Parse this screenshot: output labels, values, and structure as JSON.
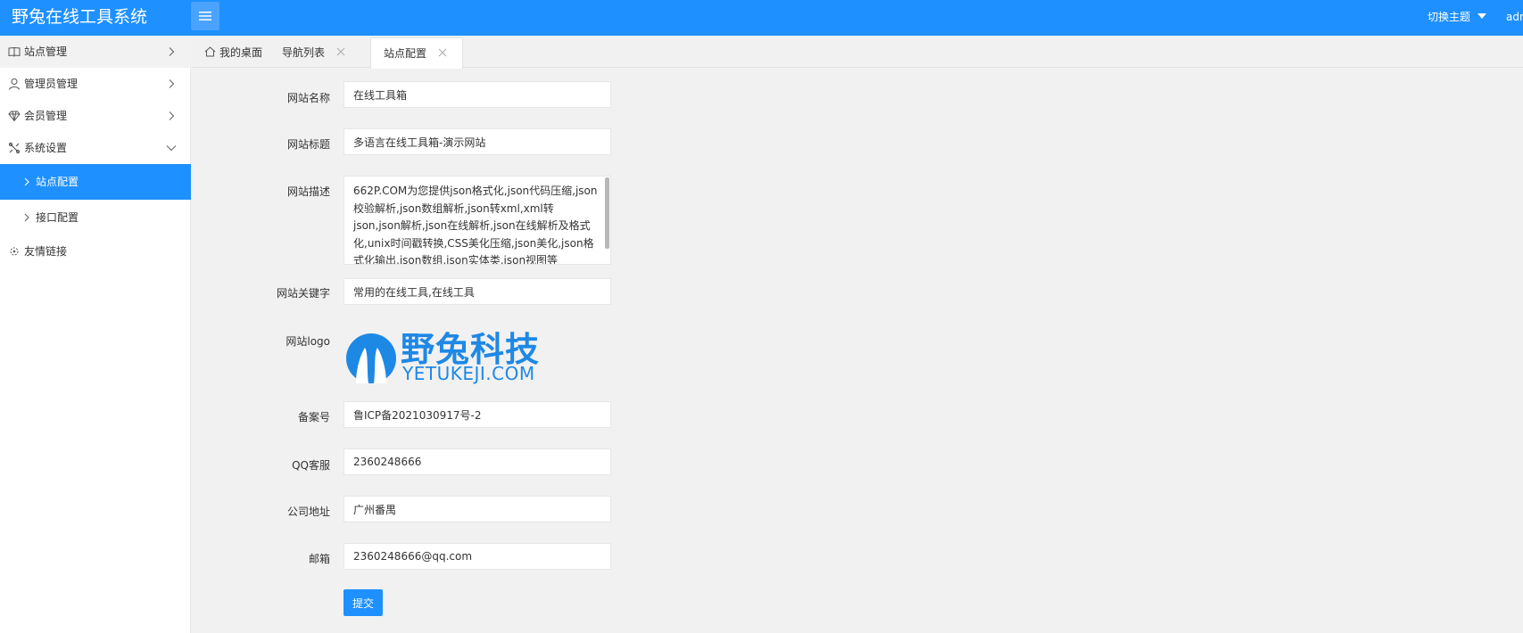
{
  "header": {
    "app_title": "野兔在线工具系统",
    "theme_switch": "切换主题",
    "admin_user": "admin"
  },
  "sidebar": {
    "items": [
      {
        "label": "站点管理",
        "icon": "book-icon"
      },
      {
        "label": "管理员管理",
        "icon": "user-icon"
      },
      {
        "label": "会员管理",
        "icon": "diamond-icon"
      },
      {
        "label": "系统设置",
        "icon": "tools-icon"
      },
      {
        "label": "站点配置"
      },
      {
        "label": "接口配置"
      },
      {
        "label": "友情链接",
        "icon": "link-icon"
      }
    ]
  },
  "tabs": [
    {
      "label": "我的桌面",
      "icon": "home-icon"
    },
    {
      "label": "导航列表"
    },
    {
      "label": "站点配置"
    }
  ],
  "form": {
    "site_name": {
      "label": "网站名称",
      "value": "在线工具箱"
    },
    "site_title": {
      "label": "网站标题",
      "value": "多语言在线工具箱-演示网站"
    },
    "site_desc": {
      "label": "网站描述",
      "value": "662P.COM为您提供json格式化,json代码压缩,json校验解析,json数组解析,json转xml,xml转json,json解析,json在线解析,json在线解析及格式化,unix时间戳转换,CSS美化压缩,json美化,json格式化输出,json数组,json实体类,json视图等"
    },
    "site_keywords": {
      "label": "网站关键字",
      "value": "常用的在线工具,在线工具"
    },
    "site_logo": {
      "label": "网站logo",
      "logo_cn": "野兔科技",
      "logo_en": "YETUKEJI.COM"
    },
    "icp": {
      "label": "备案号",
      "value": "鲁ICP备2021030917号-2"
    },
    "qq": {
      "label": "QQ客服",
      "value": "2360248666"
    },
    "address": {
      "label": "公司地址",
      "value": "广州番禺"
    },
    "email": {
      "label": "邮箱",
      "value": "2360248666@qq.com"
    },
    "submit_label": "提交"
  },
  "colors": {
    "primary": "#1e90ff",
    "sidebar_bg": "#ffffff",
    "content_bg": "#f1f1f1"
  }
}
